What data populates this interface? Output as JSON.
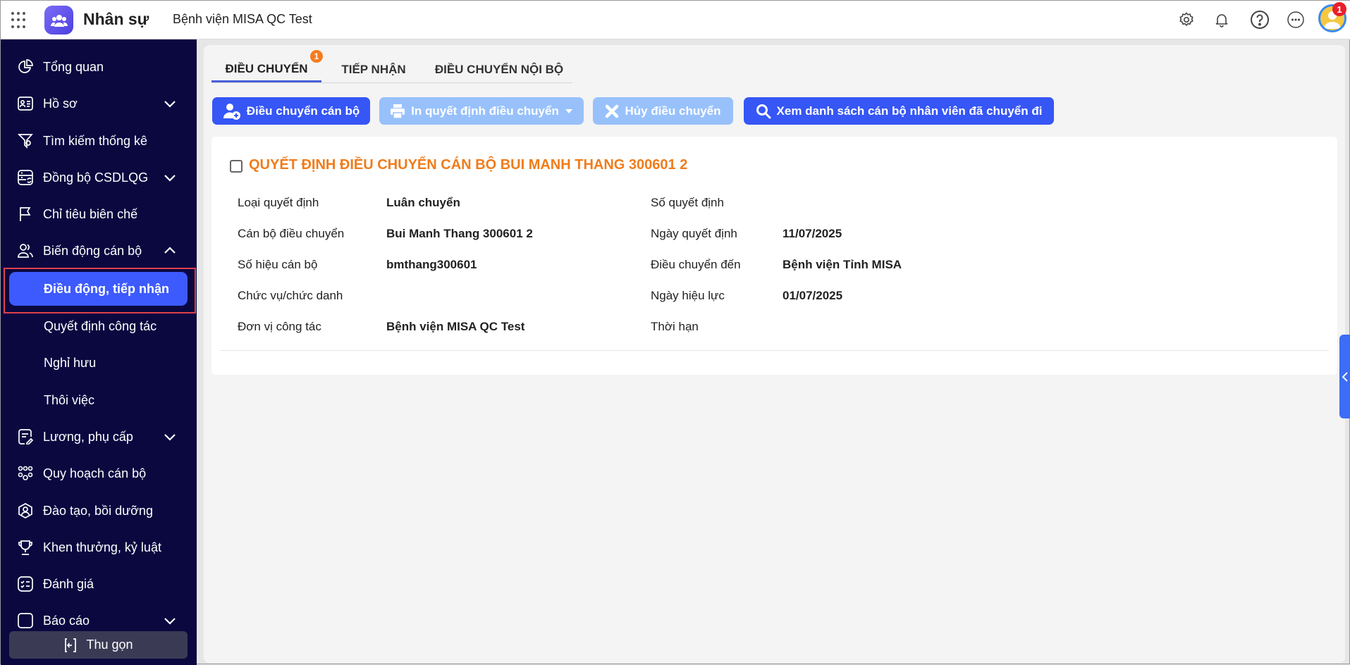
{
  "header": {
    "app_name": "Nhân sự",
    "org_name": "Bệnh viện MISA QC Test",
    "avatar_badge": "1"
  },
  "sidebar": {
    "items": [
      {
        "label": "Tổng quan",
        "icon": "pie-chart-icon"
      },
      {
        "label": "Hồ sơ",
        "icon": "id-card-icon",
        "expandable": true
      },
      {
        "label": "Tìm kiếm thống kê",
        "icon": "filter-search-icon"
      },
      {
        "label": "Đồng bộ CSDLQG",
        "icon": "database-sync-icon",
        "expandable": true
      },
      {
        "label": "Chỉ tiêu biên chế",
        "icon": "flag-icon"
      },
      {
        "label": "Biến động cán bộ",
        "icon": "users-icon",
        "expanded": true
      }
    ],
    "sub_items": [
      "Điều động, tiếp nhận",
      "Quyết định công tác",
      "Nghỉ hưu",
      "Thôi việc"
    ],
    "items2": [
      {
        "label": "Lương, phụ cấp",
        "icon": "note-edit-icon",
        "expandable": true
      },
      {
        "label": "Quy hoạch cán bộ",
        "icon": "org-chart-icon"
      },
      {
        "label": "Đào tạo, bồi dưỡng",
        "icon": "user-hexagon-icon"
      },
      {
        "label": "Khen thưởng, kỷ luật",
        "icon": "trophy-icon"
      },
      {
        "label": "Đánh giá",
        "icon": "checklist-icon"
      },
      {
        "label": "Báo cáo",
        "icon": "report-icon",
        "expandable": true
      }
    ],
    "collapse_label": "Thu gọn"
  },
  "tabs": [
    {
      "label": "ĐIỀU CHUYỂN",
      "badge": "1"
    },
    {
      "label": "TIẾP NHẬN"
    },
    {
      "label": "ĐIỀU CHUYỂN NỘI BỘ"
    }
  ],
  "toolbar": {
    "transfer": "Điều chuyển cán bộ",
    "print": "In quyết định điều chuyển",
    "cancel": "Hủy điều chuyển",
    "view_list": "Xem danh sách cán bộ nhân viên đã chuyển đi"
  },
  "card": {
    "title": "QUYẾT ĐỊNH ĐIỀU CHUYỂN CÁN BỘ BUI MANH THANG 300601 2",
    "left": [
      {
        "label": "Loại quyết định",
        "value": "Luân chuyển"
      },
      {
        "label": "Cán bộ điều chuyển",
        "value": "Bui Manh Thang 300601 2"
      },
      {
        "label": "Số hiệu cán bộ",
        "value": "bmthang300601"
      },
      {
        "label": "Chức vụ/chức danh",
        "value": ""
      },
      {
        "label": "Đơn vị công tác",
        "value": "Bệnh viện MISA QC Test"
      }
    ],
    "right": [
      {
        "label": "Số quyết định",
        "value": ""
      },
      {
        "label": "Ngày quyết định",
        "value": "11/07/2025"
      },
      {
        "label": "Điều chuyển đến",
        "value": "Bệnh viện Tỉnh MISA"
      },
      {
        "label": "Ngày hiệu lực",
        "value": "01/07/2025"
      },
      {
        "label": "Thời hạn",
        "value": ""
      }
    ]
  },
  "colors": {
    "sidebar_bg": "#0b0840",
    "accent": "#3656f5",
    "title_orange": "#f07c1b"
  }
}
